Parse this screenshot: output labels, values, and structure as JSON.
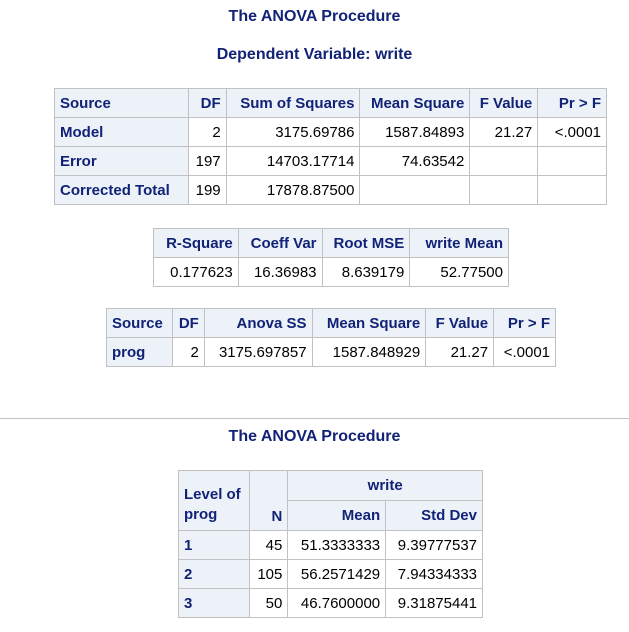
{
  "section1": {
    "title": "The ANOVA Procedure",
    "subtitle": "Dependent Variable: write"
  },
  "anova_table": {
    "headers": [
      "Source",
      "DF",
      "Sum of Squares",
      "Mean Square",
      "F Value",
      "Pr > F"
    ],
    "rows": [
      [
        "Model",
        "2",
        "3175.69786",
        "1587.84893",
        "21.27",
        "<.0001"
      ],
      [
        "Error",
        "197",
        "14703.17714",
        "74.63542",
        "",
        ""
      ],
      [
        "Corrected Total",
        "199",
        "17878.87500",
        "",
        "",
        ""
      ]
    ]
  },
  "fit_table": {
    "headers": [
      "R-Square",
      "Coeff Var",
      "Root MSE",
      "write Mean"
    ],
    "row": [
      "0.177623",
      "16.36983",
      "8.639179",
      "52.77500"
    ]
  },
  "type_table": {
    "headers": [
      "Source",
      "DF",
      "Anova SS",
      "Mean Square",
      "F Value",
      "Pr > F"
    ],
    "row": [
      "prog",
      "2",
      "3175.697857",
      "1587.848929",
      "21.27",
      "<.0001"
    ]
  },
  "section2": {
    "title": "The ANOVA Procedure"
  },
  "means_table": {
    "level_header": "Level of prog",
    "n_header": "N",
    "group_header": "write",
    "sub_headers": [
      "Mean",
      "Std Dev"
    ],
    "rows": [
      [
        "1",
        "45",
        "51.3333333",
        "9.39777537"
      ],
      [
        "2",
        "105",
        "56.2571429",
        "7.94334333"
      ],
      [
        "3",
        "50",
        "46.7600000",
        "9.31875441"
      ]
    ]
  }
}
